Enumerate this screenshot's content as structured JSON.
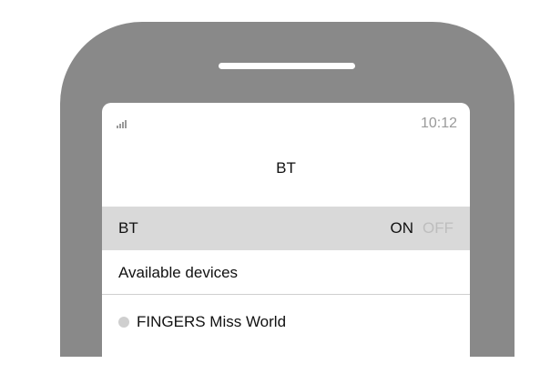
{
  "status_bar": {
    "signal_icon": "signal-bars-icon",
    "time": "10:12"
  },
  "screen": {
    "title": "BT"
  },
  "bluetooth_row": {
    "label": "BT",
    "on_label": "ON",
    "off_label": "OFF",
    "state": "ON"
  },
  "available": {
    "header": "Available devices",
    "devices": [
      {
        "name": "FINGERS Miss World",
        "status_icon": "device-status-dot-icon"
      }
    ]
  },
  "colors": {
    "phone_frame": "#898989",
    "highlight_row": "#d9d9d9",
    "inactive_text": "#bdbdbd",
    "status_text": "#9a9a9a"
  }
}
